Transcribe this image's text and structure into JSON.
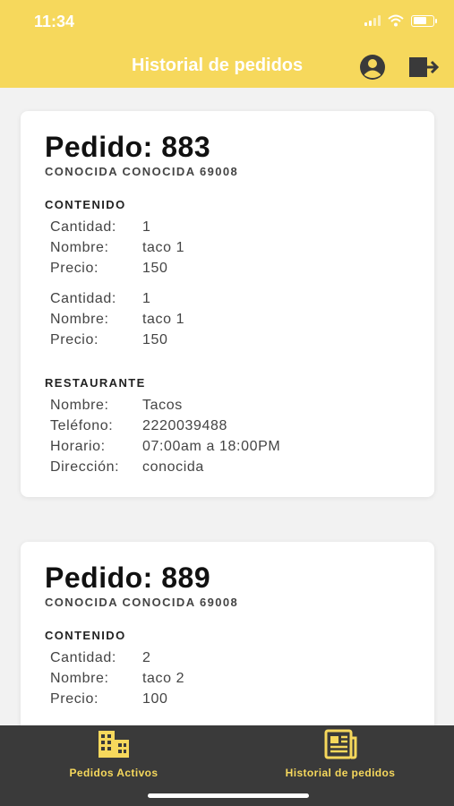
{
  "status_bar": {
    "time": "11:34"
  },
  "header": {
    "title": "Historial de pedidos",
    "user_icon": "user-circle-icon",
    "logout_icon": "logout-icon"
  },
  "orders": [
    {
      "title": "Pedido: 883",
      "address": "CONOCIDA CONOCIDA 69008",
      "content_label": "CONTENIDO",
      "items": [
        {
          "qty_label": "Cantidad:",
          "qty": "1",
          "name_label": "Nombre:",
          "name": "taco 1",
          "price_label": "Precio:",
          "price": "150"
        },
        {
          "qty_label": "Cantidad:",
          "qty": "1",
          "name_label": "Nombre:",
          "name": "taco 1",
          "price_label": "Precio:",
          "price": "150"
        }
      ],
      "restaurant_label": "RESTAURANTE",
      "restaurant": {
        "name_label": "Nombre:",
        "name": "Tacos",
        "phone_label": "Teléfono:",
        "phone": "2220039488",
        "hours_label": "Horario:",
        "hours": "07:00am a 18:00PM",
        "address_label": "Dirección:",
        "address": "conocida"
      }
    },
    {
      "title": "Pedido: 889",
      "address": "CONOCIDA CONOCIDA 69008",
      "content_label": "CONTENIDO",
      "items": [
        {
          "qty_label": "Cantidad:",
          "qty": "2",
          "name_label": "Nombre:",
          "name": "taco 2",
          "price_label": "Precio:",
          "price": "100"
        }
      ]
    }
  ],
  "tabbar": {
    "active_label": "Pedidos Activos",
    "history_label": "Historial de pedidos"
  },
  "colors": {
    "accent": "#f6d85c",
    "tabbar": "#3a3a3a"
  }
}
